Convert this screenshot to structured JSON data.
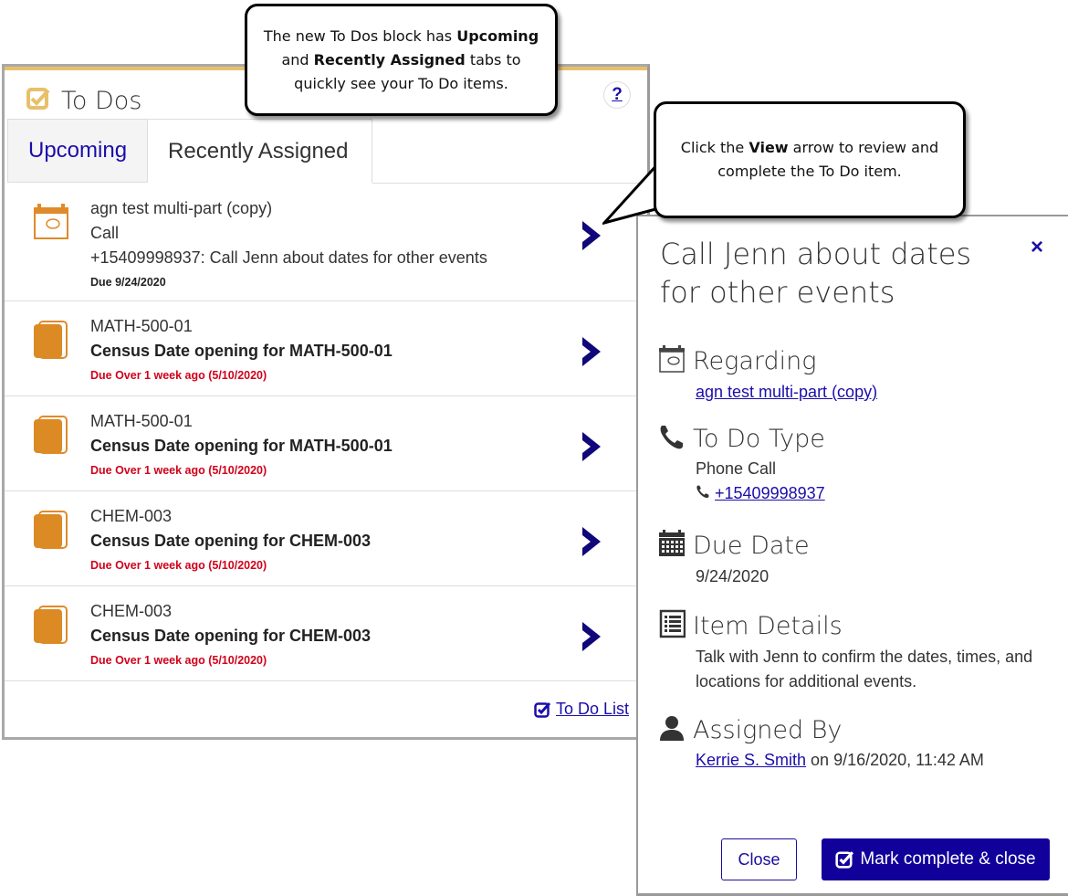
{
  "callouts": {
    "tabs_note": {
      "part1": "The new To Dos block has ",
      "bold1": "Upcoming",
      "part2": " and ",
      "bold2": "Recently Assigned",
      "part3": " tabs to quickly see your To Do items."
    },
    "view_note": {
      "part1": "Click the ",
      "bold1": "View",
      "part2": " arrow to review and complete the To Do item."
    }
  },
  "todos": {
    "title": "To Dos",
    "help_label": "?",
    "accent_color": "#e8c06a",
    "tabs": [
      {
        "label": "Upcoming",
        "active": true
      },
      {
        "label": "Recently Assigned",
        "active": false
      }
    ],
    "items": [
      {
        "icon": "calendar-icon",
        "line1": "agn test multi-part (copy)",
        "line2": "Call",
        "line3": "+15409998937: Call Jenn about dates for other events",
        "due": "Due 9/24/2020",
        "overdue": false
      },
      {
        "icon": "book-icon",
        "line1": "MATH-500-01",
        "line2": "Census Date opening for MATH-500-01",
        "due": "Due Over 1 week ago (5/10/2020)",
        "overdue": true
      },
      {
        "icon": "book-icon",
        "line1": "MATH-500-01",
        "line2": "Census Date opening for MATH-500-01",
        "due": "Due Over 1 week ago (5/10/2020)",
        "overdue": true
      },
      {
        "icon": "book-icon",
        "line1": "CHEM-003",
        "line2": "Census Date opening for CHEM-003",
        "due": "Due Over 1 week ago (5/10/2020)",
        "overdue": true
      },
      {
        "icon": "book-icon",
        "line1": "CHEM-003",
        "line2": "Census Date opening for CHEM-003",
        "due": "Due Over 1 week ago (5/10/2020)",
        "overdue": true
      }
    ],
    "todo_list_link": "To Do List"
  },
  "detail": {
    "title": "Call Jenn about dates for other events",
    "close_icon": "×",
    "regarding": {
      "label": "Regarding",
      "link": "agn test multi-part (copy)"
    },
    "todo_type": {
      "label": "To Do Type",
      "value": "Phone Call",
      "phone": "+15409998937"
    },
    "due_date": {
      "label": "Due Date",
      "value": "9/24/2020"
    },
    "item_details": {
      "label": "Item Details",
      "value": "Talk with Jenn to confirm the dates, times, and locations for additional events."
    },
    "assigned_by": {
      "label": "Assigned By",
      "name": "Kerrie S. Smith",
      "suffix": " on 9/16/2020, 11:42 AM"
    },
    "close_button": "Close",
    "mark_button": "Mark complete & close",
    "primary_color": "#12009a"
  }
}
